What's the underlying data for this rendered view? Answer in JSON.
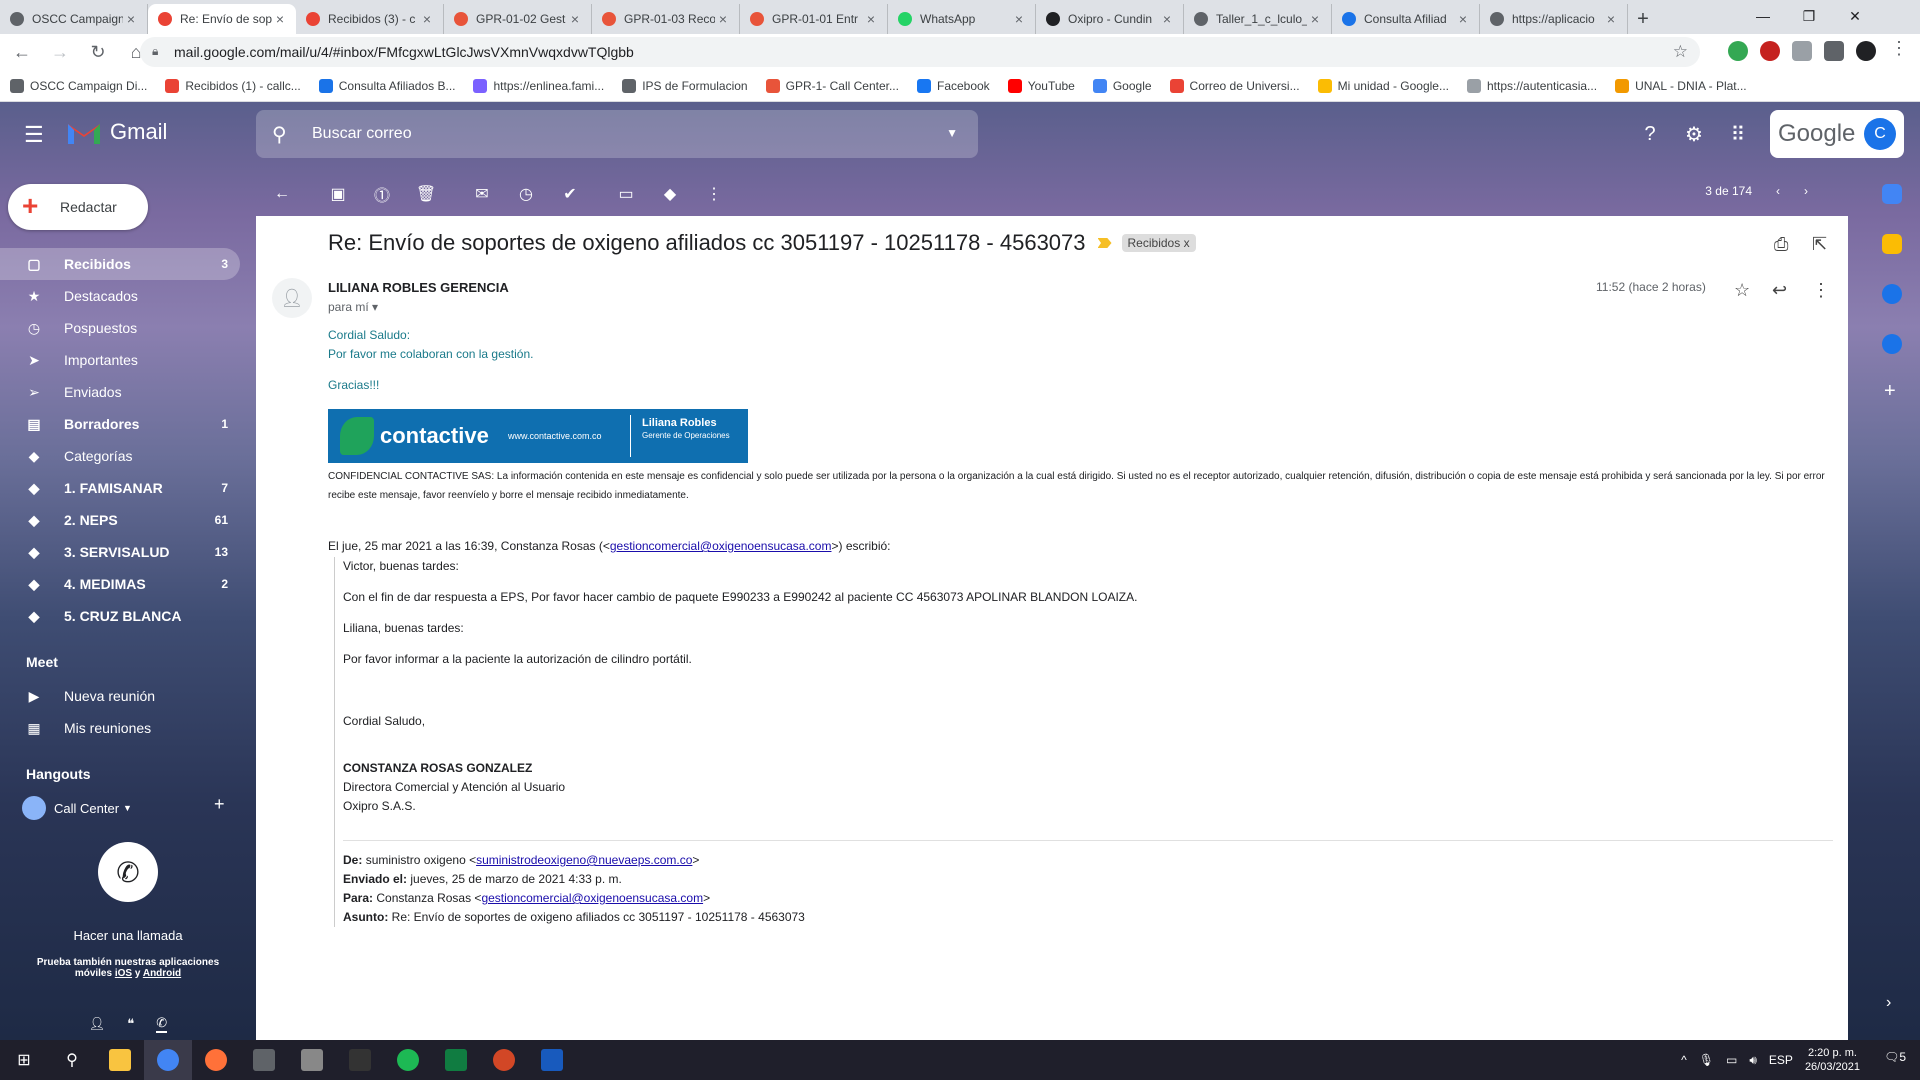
{
  "tabs": [
    {
      "title": "OSCC Campaign",
      "color": "#5f6368"
    },
    {
      "title": "Re: Envío de sop",
      "color": "#ea4335"
    },
    {
      "title": "Recibidos (3) - c",
      "color": "#ea4335"
    },
    {
      "title": "GPR-01-02 Gest",
      "color": "#e8543a"
    },
    {
      "title": "GPR-01-03 Reco",
      "color": "#e8543a"
    },
    {
      "title": "GPR-01-01 Entr",
      "color": "#e8543a"
    },
    {
      "title": "WhatsApp",
      "color": "#25d366"
    },
    {
      "title": "Oxipro - Cundin",
      "color": "#202124"
    },
    {
      "title": "Taller_1_c_lculo_",
      "color": "#5f6368"
    },
    {
      "title": "Consulta Afiliad",
      "color": "#1a73e8"
    },
    {
      "title": "https://aplicacio",
      "color": "#5f6368"
    }
  ],
  "url": "mail.google.com/mail/u/4/#inbox/FMfcgxwLtGlcJwsVXmnVwqxdvwTQlgbb",
  "bookmarks": [
    {
      "label": "OSCC Campaign Di...",
      "color": "#5f6368"
    },
    {
      "label": "Recibidos (1) - callc...",
      "color": "#ea4335"
    },
    {
      "label": "Consulta Afiliados B...",
      "color": "#1a73e8"
    },
    {
      "label": "https://enlinea.fami...",
      "color": "#7b61ff"
    },
    {
      "label": "IPS de Formulacion",
      "color": "#5f6368"
    },
    {
      "label": "GPR-1- Call Center...",
      "color": "#e8543a"
    },
    {
      "label": "Facebook",
      "color": "#1877f2"
    },
    {
      "label": "YouTube",
      "color": "#ff0000"
    },
    {
      "label": "Google",
      "color": "#4285f4"
    },
    {
      "label": "Correo de Universi...",
      "color": "#ea4335"
    },
    {
      "label": "Mi unidad - Google...",
      "color": "#fbbc04"
    },
    {
      "label": "https://autenticasia...",
      "color": "#9aa0a6"
    },
    {
      "label": "UNAL - DNIA - Plat...",
      "color": "#f29900"
    }
  ],
  "gmail": {
    "brand": "Gmail",
    "search_placeholder": "Buscar correo",
    "google_word": "Google",
    "avatar_letter": "C",
    "compose": "Redactar"
  },
  "nav": [
    {
      "label": "Recibidos",
      "count": "3",
      "icon": "inbox-icon",
      "glyph": "▢",
      "selected": true,
      "bold": true
    },
    {
      "label": "Destacados",
      "count": "",
      "icon": "star-icon",
      "glyph": "★",
      "selected": false,
      "bold": false
    },
    {
      "label": "Pospuestos",
      "count": "",
      "icon": "clock-icon",
      "glyph": "◷",
      "selected": false,
      "bold": false
    },
    {
      "label": "Importantes",
      "count": "",
      "icon": "important-icon",
      "glyph": "➤",
      "selected": false,
      "bold": false
    },
    {
      "label": "Enviados",
      "count": "",
      "icon": "send-icon",
      "glyph": "➢",
      "selected": false,
      "bold": false
    },
    {
      "label": "Borradores",
      "count": "1",
      "icon": "draft-icon",
      "glyph": "▤",
      "selected": false,
      "bold": true
    },
    {
      "label": "Categorías",
      "count": "",
      "icon": "label-icon",
      "glyph": "◆",
      "selected": false,
      "bold": false
    },
    {
      "label": "1. FAMISANAR",
      "count": "7",
      "icon": "label-icon",
      "glyph": "◆",
      "selected": false,
      "bold": true
    },
    {
      "label": "2. NEPS",
      "count": "61",
      "icon": "label-icon",
      "glyph": "◆",
      "selected": false,
      "bold": true
    },
    {
      "label": "3. SERVISALUD",
      "count": "13",
      "icon": "label-icon",
      "glyph": "◆",
      "selected": false,
      "bold": true
    },
    {
      "label": "4. MEDIMAS",
      "count": "2",
      "icon": "label-icon",
      "glyph": "◆",
      "selected": false,
      "bold": true
    },
    {
      "label": "5. CRUZ BLANCA",
      "count": "",
      "icon": "label-icon",
      "glyph": "◆",
      "selected": false,
      "bold": true
    }
  ],
  "meet": {
    "title": "Meet",
    "items": [
      {
        "label": "Nueva reunión",
        "glyph": "▶"
      },
      {
        "label": "Mis reuniones",
        "glyph": "▦"
      }
    ]
  },
  "hangouts": {
    "title": "Hangouts",
    "user": "Call Center",
    "call_label": "Hacer una llamada",
    "apps_line1": "Prueba también nuestras aplicaciones",
    "apps_line2": "móviles",
    "ios": "iOS",
    "y": "y",
    "android": "Android"
  },
  "pager": "3 de 174",
  "email": {
    "subject": "Re: Envío de soportes de oxigeno afiliados cc 3051197 - 10251178 - 4563073",
    "label": "Recibidos",
    "label_x": "x",
    "sender": "LILIANA ROBLES GERENCIA",
    "to": "para mí",
    "time": "11:52 (hace 2 horas)",
    "greeting": "Cordial Saludo:",
    "line1": "Por favor me colaboran con la gestión.",
    "thanks": "Gracias!!!",
    "sig": {
      "brand": "contactive",
      "www": "www.contactive.com.co",
      "name": "Liliana Robles",
      "role": "Gerente de Operaciones"
    },
    "confidential": "CONFIDENCIAL CONTACTIVE SAS: La información contenida en este mensaje es confidencial y solo puede ser utilizada por la persona o la organización a la cual está dirigido. Si usted no es el receptor autorizado, cualquier retención, difusión, distribución o copia de este mensaje está prohibida y será sancionada por la ley. Si por error recibe este mensaje, favor reenvíelo y borre el mensaje recibido inmediatamente.",
    "wrote_prefix": "El jue, 25 mar 2021 a las 16:39, Constanza Rosas (<",
    "wrote_email": "gestioncomercial@oxigenoensucasa.com",
    "wrote_suffix": ">) escribió:",
    "q1": "Victor, buenas tardes:",
    "q2": "Con el fin de dar respuesta a EPS, Por favor hacer cambio de paquete E990233 a E990242 al paciente CC 4563073 APOLINAR BLANDON LOAIZA.",
    "q3": "Liliana, buenas tardes:",
    "q4": "Por favor informar a la paciente la autorización de cilindro portátil.",
    "q5": "Cordial Saludo,",
    "sig2_name": "CONSTANZA ROSAS GONZALEZ",
    "sig2_role": "Directora Comercial y Atención al Usuario",
    "sig2_company": "Oxipro S.A.S.",
    "fwd": {
      "de_label": "De:",
      "de_name": "suministro oxigeno <",
      "de_email": "suministrodeoxigeno@nuevaeps.com.co",
      "de_close": ">",
      "enviado_label": "Enviado el:",
      "enviado": "jueves, 25 de marzo de 2021 4:33 p. m.",
      "para_label": "Para:",
      "para_name": "Constanza Rosas <",
      "para_email": "gestioncomercial@oxigenoensucasa.com",
      "para_close": ">",
      "asunto_label": "Asunto:",
      "asunto": "Re: Envío de soportes de oxigeno afiliados cc 3051197 - 10251178 - 4563073"
    }
  },
  "taskbar": {
    "lang": "ESP",
    "time": "2:20 p. m.",
    "date": "26/03/2021",
    "notif": "5"
  }
}
